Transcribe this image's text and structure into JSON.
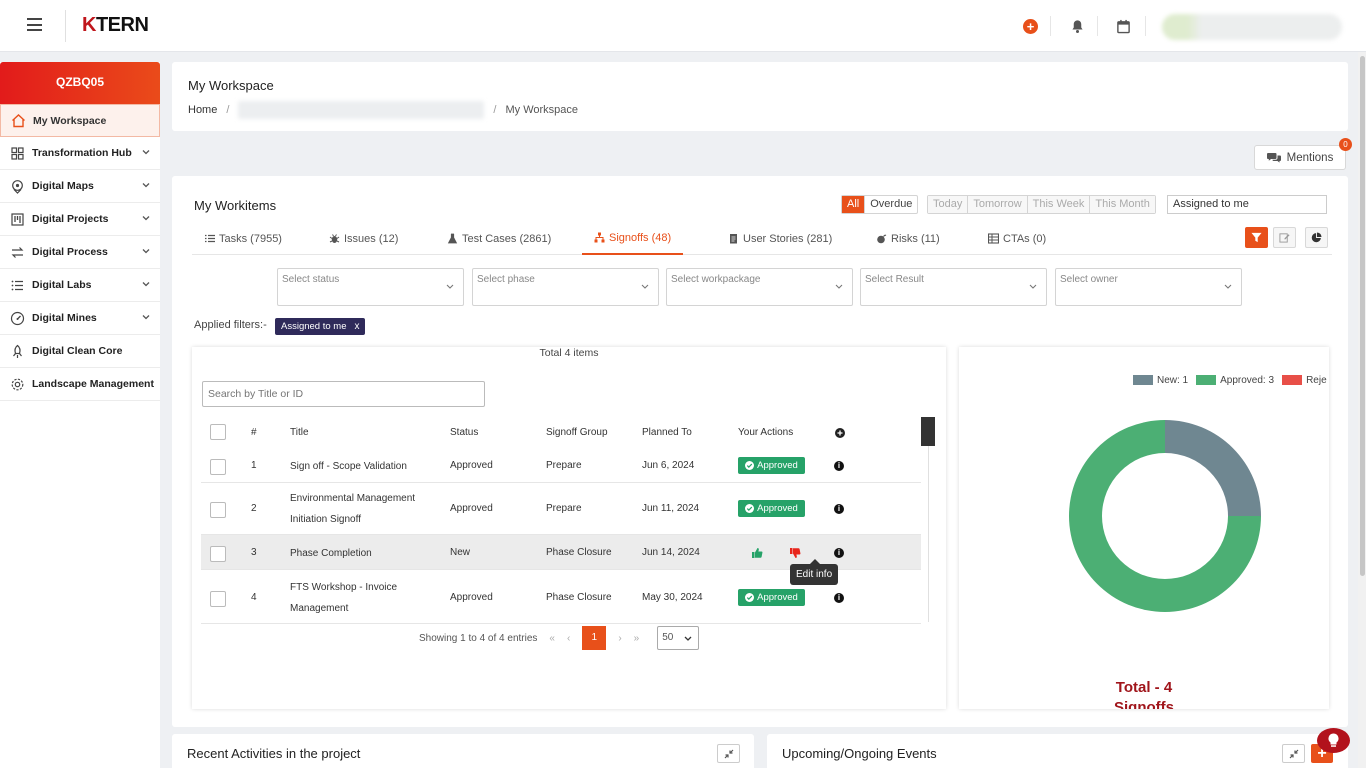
{
  "brand": {
    "logo_k": "K",
    "logo_rest": "TERN"
  },
  "topbar": {
    "add_icon": "plus-circle-icon",
    "bell_icon": "bell-icon",
    "calendar_icon": "calendar-icon"
  },
  "sidebar": {
    "project_code": "QZBQ05",
    "items": [
      {
        "label": "My Workspace",
        "icon": "home-icon",
        "active": true,
        "chevron": false
      },
      {
        "label": "Transformation Hub",
        "icon": "grid-icon",
        "chevron": true
      },
      {
        "label": "Digital Maps",
        "icon": "map-pin-icon",
        "chevron": true
      },
      {
        "label": "Digital Projects",
        "icon": "kanban-icon",
        "chevron": true
      },
      {
        "label": "Digital Process",
        "icon": "arrows-icon",
        "chevron": true
      },
      {
        "label": "Digital Labs",
        "icon": "list-icon",
        "chevron": true
      },
      {
        "label": "Digital Mines",
        "icon": "gauge-icon",
        "chevron": true
      },
      {
        "label": "Digital Clean Core",
        "icon": "rocket-icon",
        "chevron": false
      },
      {
        "label": "Landscape Management",
        "icon": "gear-icon",
        "chevron": false
      }
    ]
  },
  "workspace": {
    "title": "My Workspace",
    "crumb_home": "Home",
    "crumb_slash": "/",
    "crumb_current": "My Workspace"
  },
  "mentions": {
    "label": "Mentions",
    "count": "0"
  },
  "workitems": {
    "title": "My Workitems",
    "filters_primary": [
      "All",
      "Overdue"
    ],
    "filters_time": [
      "Today",
      "Tomorrow",
      "This Week",
      "This Month"
    ],
    "assigned": "Assigned to me",
    "tabs": [
      {
        "label": "Tasks (7955)",
        "icon": "list-icon"
      },
      {
        "label": "Issues (12)",
        "icon": "bug-icon"
      },
      {
        "label": "Test Cases (2861)",
        "icon": "flask-icon"
      },
      {
        "label": "Signoffs (48)",
        "icon": "sitemap-icon",
        "active": true
      },
      {
        "label": "User Stories (281)",
        "icon": "document-icon"
      },
      {
        "label": "Risks (11)",
        "icon": "bomb-icon"
      },
      {
        "label": "CTAs (0)",
        "icon": "table-icon"
      }
    ],
    "selects": [
      "Select status",
      "Select phase",
      "Select workpackage",
      "Select Result",
      "Select owner"
    ],
    "applied_label": "Applied filters:-",
    "applied_chip": "Assigned to me",
    "applied_chip_close": "x"
  },
  "table": {
    "total": "Total 4 items",
    "search_placeholder": "Search by Title or ID",
    "headers": {
      "num": "#",
      "title": "Title",
      "status": "Status",
      "group": "Signoff Group",
      "planned": "Planned To",
      "actions": "Your Actions"
    },
    "rows": [
      {
        "num": "1",
        "title": "Sign off - Scope Validation",
        "status": "Approved",
        "group": "Prepare",
        "planned": "Jun 6, 2024",
        "action": "Approved"
      },
      {
        "num": "2",
        "title": "Environmental Management Initiation Signoff",
        "status": "Approved",
        "group": "Prepare",
        "planned": "Jun 11, 2024",
        "action": "Approved"
      },
      {
        "num": "3",
        "title": "Phase Completion",
        "status": "New",
        "group": "Phase Closure",
        "planned": "Jun 14, 2024",
        "action": ""
      },
      {
        "num": "4",
        "title": "FTS Workshop - Invoice Management",
        "status": "Approved",
        "group": "Phase Closure",
        "planned": "May 30, 2024",
        "action": "Approved"
      }
    ],
    "tooltip": "Edit info",
    "pagination": {
      "showing": "Showing 1 to 4 of 4 entries",
      "first": "«",
      "prev": "‹",
      "current": "1",
      "next": "›",
      "last": "»",
      "page_size": "50"
    }
  },
  "chart_data": {
    "type": "pie",
    "categories": [
      "New",
      "Approved",
      "Rejected"
    ],
    "values": [
      1,
      3,
      0
    ],
    "legend": [
      "New: 1",
      "Approved: 3",
      "Reje"
    ],
    "colors": [
      "#6f8791",
      "#4caf74",
      "#e84f48"
    ],
    "title": "Total - 4",
    "subtitle": "Signoffs",
    "legend_position": "top-right"
  },
  "bottom": {
    "recent": "Recent Activities in the project",
    "events": "Upcoming/Ongoing Events"
  },
  "colors": {
    "accent": "#e8501a",
    "brand_red": "#c0161c",
    "approved": "#26a268",
    "chip": "#2f2a5a"
  }
}
